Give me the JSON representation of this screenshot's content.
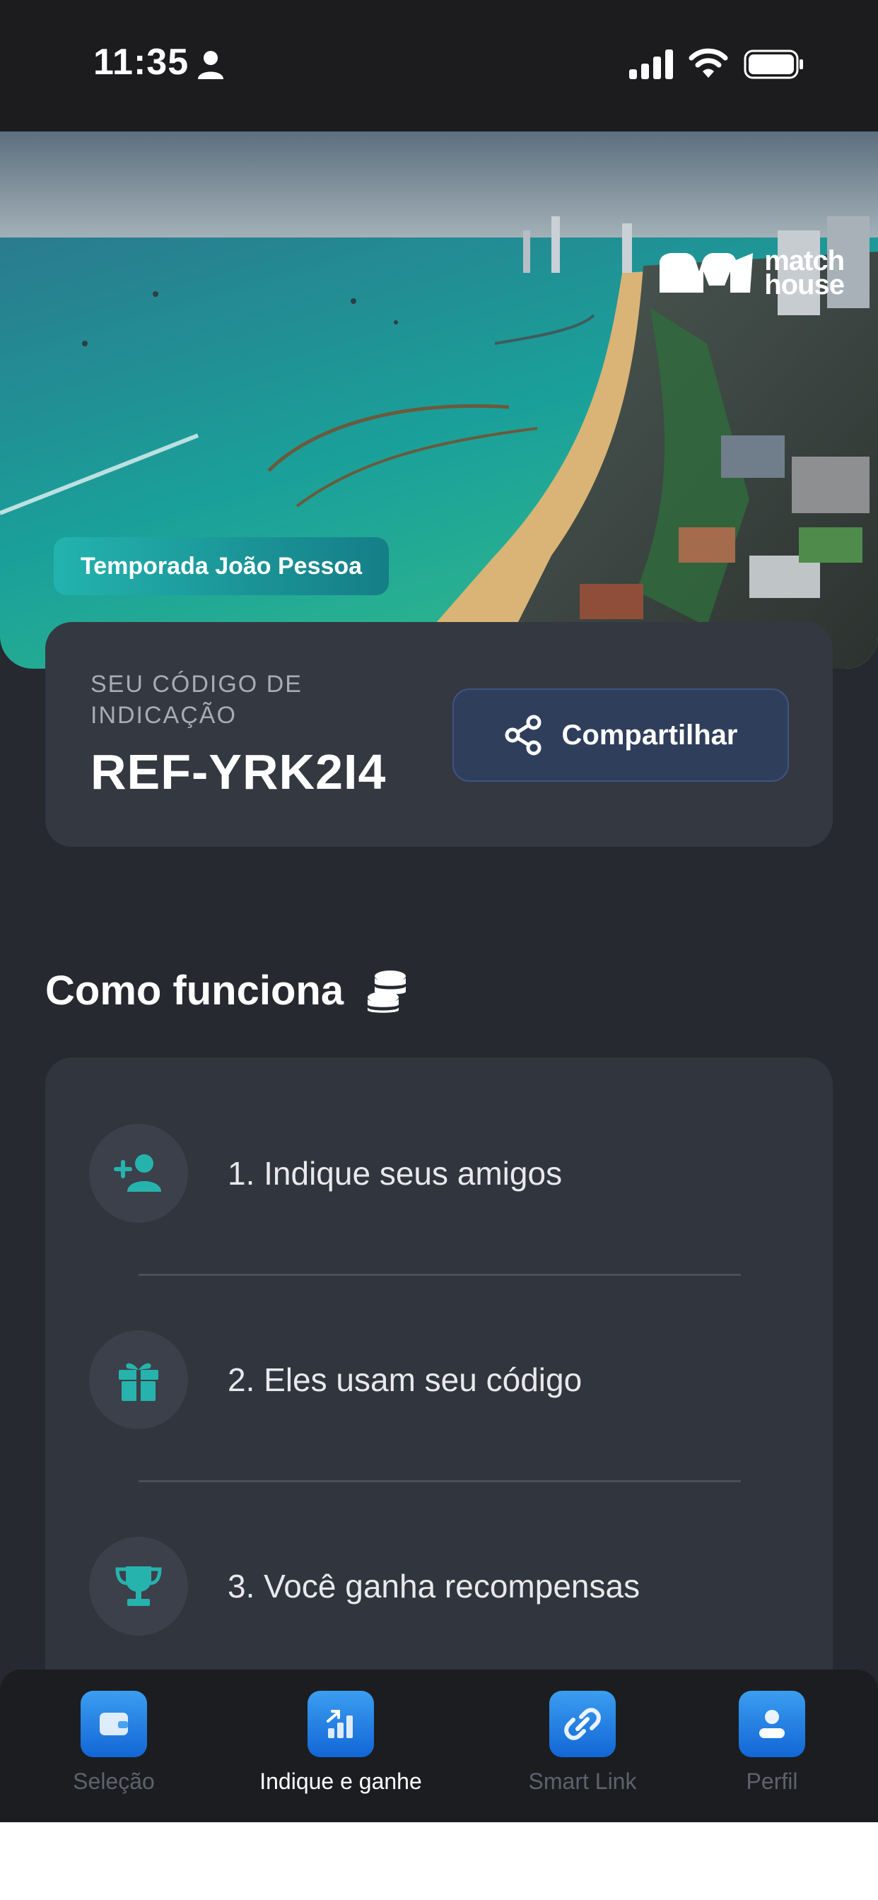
{
  "status_bar": {
    "time": "11:35"
  },
  "hero": {
    "brand": {
      "line1": "match",
      "line2": "house"
    },
    "badge": "Temporada João Pessoa"
  },
  "referral": {
    "caption": "SEU CÓDIGO DE INDICAÇÃO",
    "code": "REF-YRK2I4",
    "share_label": "Compartilhar"
  },
  "how_it_works": {
    "title": "Como funciona",
    "steps": [
      {
        "label": "1. Indique seus amigos",
        "icon": "add-user-icon"
      },
      {
        "label": "2. Eles usam seu código",
        "icon": "gift-icon"
      },
      {
        "label": "3. Você ganha recompensas",
        "icon": "trophy-icon"
      }
    ]
  },
  "bottom_nav": {
    "items": [
      {
        "label": "Seleção",
        "icon": "wallet-icon",
        "active": false
      },
      {
        "label": "Indique e ganhe",
        "icon": "chart-up-icon",
        "active": true
      },
      {
        "label": "Smart Link",
        "icon": "link-icon",
        "active": false
      },
      {
        "label": "Perfil",
        "icon": "profile-icon",
        "active": false
      }
    ]
  },
  "colors": {
    "background": "#262930",
    "card": "#343841",
    "accent_teal": "#23b3ae",
    "share_button": "#2f3e5b",
    "nav_accent": "#1e7ee8"
  }
}
